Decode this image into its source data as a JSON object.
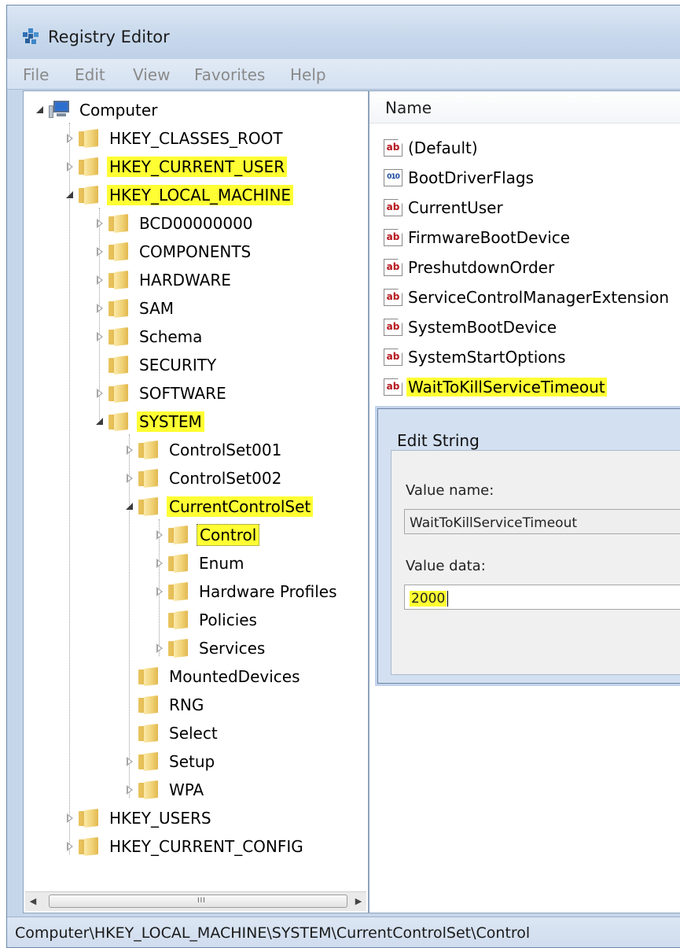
{
  "window": {
    "title": "Registry Editor",
    "menu": [
      "File",
      "Edit",
      "View",
      "Favorites",
      "Help"
    ]
  },
  "tree": {
    "root": "Computer",
    "hives": {
      "classes_root": "HKEY_CLASSES_ROOT",
      "current_user": "HKEY_CURRENT_USER",
      "local_machine": "HKEY_LOCAL_MACHINE",
      "users": "HKEY_USERS",
      "current_config": "HKEY_CURRENT_CONFIG"
    },
    "local_machine_children": [
      "BCD00000000",
      "COMPONENTS",
      "HARDWARE",
      "SAM",
      "Schema",
      "SECURITY",
      "SOFTWARE",
      "SYSTEM"
    ],
    "system_children": [
      "ControlSet001",
      "ControlSet002",
      "CurrentControlSet",
      "MountedDevices",
      "RNG",
      "Select",
      "Setup",
      "WPA"
    ],
    "current_control_set_children": [
      "Control",
      "Enum",
      "Hardware Profiles",
      "Policies",
      "Services"
    ],
    "scroll_grip": "III"
  },
  "list": {
    "column_name": "Name",
    "values": [
      {
        "name": "(Default)",
        "icon": "ab"
      },
      {
        "name": "BootDriverFlags",
        "icon": "010"
      },
      {
        "name": "CurrentUser",
        "icon": "ab"
      },
      {
        "name": "FirmwareBootDevice",
        "icon": "ab"
      },
      {
        "name": "PreshutdownOrder",
        "icon": "ab"
      },
      {
        "name": "ServiceControlManagerExtension",
        "icon": "ab"
      },
      {
        "name": "SystemBootDevice",
        "icon": "ab"
      },
      {
        "name": "SystemStartOptions",
        "icon": "ab"
      },
      {
        "name": "WaitToKillServiceTimeout",
        "icon": "ab"
      }
    ]
  },
  "dialog": {
    "title": "Edit String",
    "value_name_label": "Value name:",
    "value_name": "WaitToKillServiceTimeout",
    "value_data_label": "Value data:",
    "value_data": "2000"
  },
  "status": {
    "path": "Computer\\HKEY_LOCAL_MACHINE\\SYSTEM\\CurrentControlSet\\Control"
  },
  "colors": {
    "highlight": "#ffff33",
    "window_frame": "#c6d6ea"
  }
}
